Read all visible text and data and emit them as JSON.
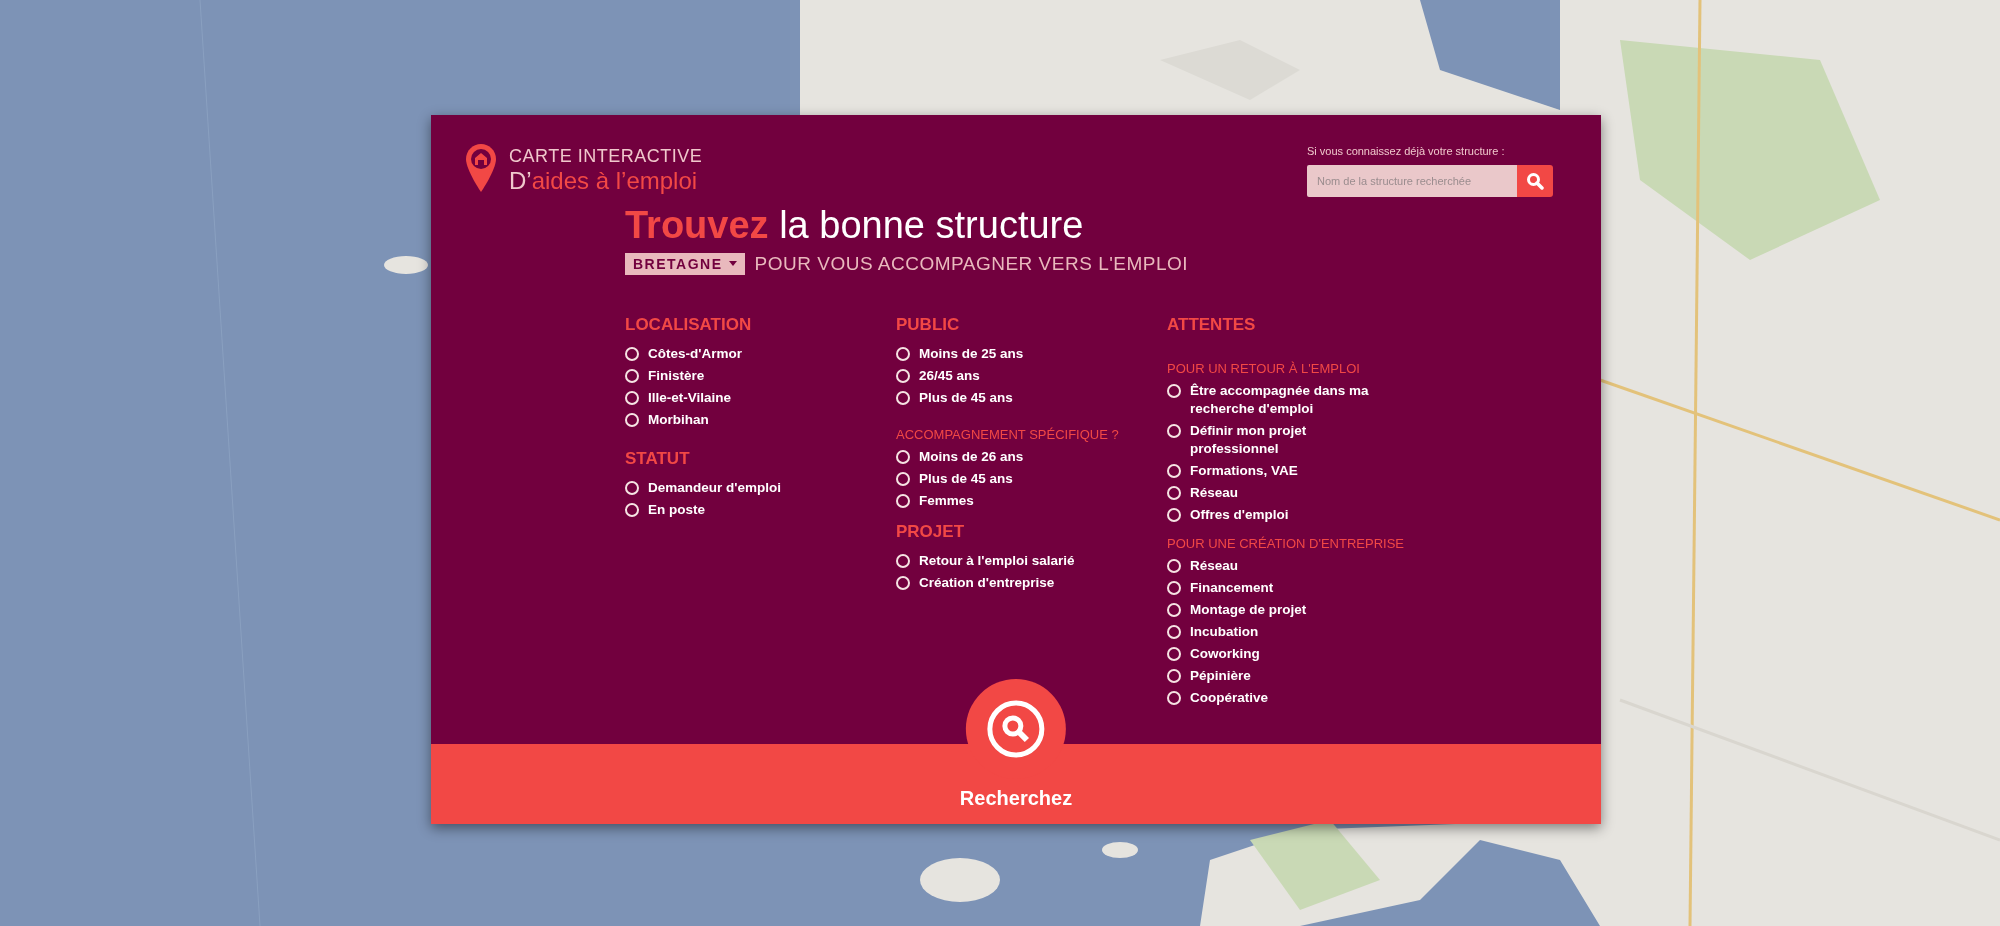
{
  "logo": {
    "line1": "CARTE INTERACTIVE",
    "prefix": "D’",
    "highlight": "aides à l’emploi"
  },
  "quick_search": {
    "label": "Si vous connaissez déjà votre structure :",
    "placeholder": "Nom de la structure recherchée"
  },
  "headline": {
    "highlight": "Trouvez",
    "rest": "la bonne structure"
  },
  "region_dropdown": {
    "value": "BRETAGNE"
  },
  "subtitle": "POUR VOUS ACCOMPAGNER VERS L'EMPLOI",
  "columns": [
    {
      "sections": [
        {
          "kind": "heading",
          "title": "LOCALISATION",
          "options": [
            {
              "label": "Côtes-d'Armor",
              "selected": false
            },
            {
              "label": "Finistère",
              "selected": false
            },
            {
              "label": "Ille-et-Vilaine",
              "selected": false
            },
            {
              "label": "Morbihan",
              "selected": false
            }
          ]
        },
        {
          "kind": "heading",
          "title": "STATUT",
          "options": [
            {
              "label": "Demandeur d'emploi",
              "selected": false
            },
            {
              "label": "En poste",
              "selected": false
            }
          ]
        }
      ]
    },
    {
      "sections": [
        {
          "kind": "heading",
          "title": "PUBLIC",
          "options": [
            {
              "label": "Moins de 25 ans",
              "selected": false
            },
            {
              "label": "26/45 ans",
              "selected": false
            },
            {
              "label": "Plus de 45 ans",
              "selected": false
            }
          ]
        },
        {
          "kind": "subheading",
          "title": "ACCOMPAGNEMENT SPÉCIFIQUE ?",
          "options": [
            {
              "label": "Moins de 26 ans",
              "selected": false
            },
            {
              "label": "Plus de 45 ans",
              "selected": false
            },
            {
              "label": "Femmes",
              "selected": false
            }
          ]
        },
        {
          "kind": "heading",
          "title": "PROJET",
          "options": [
            {
              "label": "Retour à l'emploi salarié",
              "selected": false
            },
            {
              "label": "Création d'entreprise",
              "selected": false
            }
          ]
        }
      ]
    },
    {
      "sections": [
        {
          "kind": "heading",
          "title": "ATTENTES"
        },
        {
          "kind": "subheading",
          "title": "POUR UN RETOUR À L'EMPLOI",
          "options": [
            {
              "label": "Être accompagnée dans ma recherche d'emploi",
              "selected": false
            },
            {
              "label": "Définir mon projet professionnel",
              "selected": false
            },
            {
              "label": "Formations, VAE",
              "selected": false
            },
            {
              "label": "Réseau",
              "selected": false
            },
            {
              "label": "Offres d'emploi",
              "selected": false
            }
          ]
        },
        {
          "kind": "subheading",
          "title": "POUR UNE CRÉATION D'ENTREPRISE",
          "options": [
            {
              "label": "Réseau",
              "selected": false
            },
            {
              "label": "Financement",
              "selected": false
            },
            {
              "label": "Montage de projet",
              "selected": false
            },
            {
              "label": "Incubation",
              "selected": false
            },
            {
              "label": "Coworking",
              "selected": false
            },
            {
              "label": "Pépinière",
              "selected": false
            },
            {
              "label": "Coopérative",
              "selected": false
            }
          ]
        }
      ]
    }
  ],
  "submit": {
    "label": "Recherchez"
  }
}
